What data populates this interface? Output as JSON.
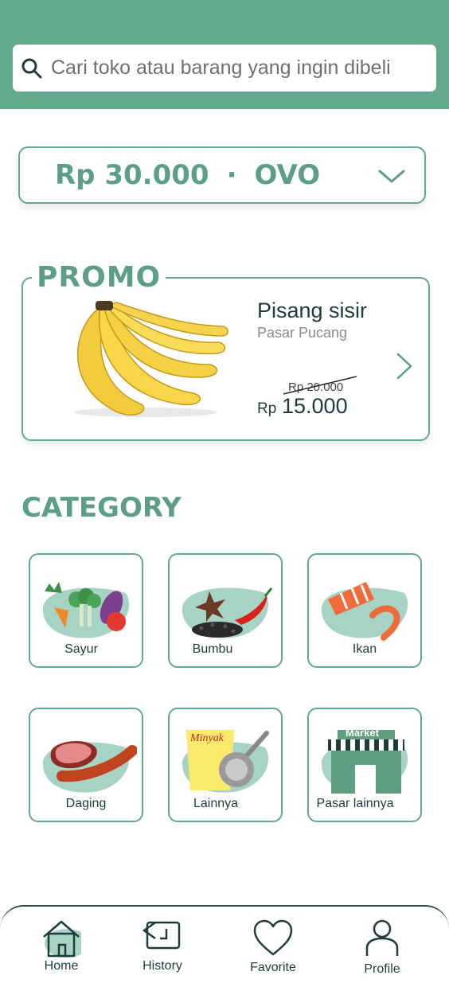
{
  "search": {
    "placeholder": "Cari toko atau barang yang ingin dibeli"
  },
  "wallet": {
    "amount": "Rp 30.000",
    "separator": "·",
    "method": "OVO"
  },
  "promo": {
    "title": "PROMO",
    "product_name": "Pisang sisir",
    "store": "Pasar Pucang",
    "old_price": "Rp 20.000",
    "currency": "Rp",
    "new_price": "15.000"
  },
  "category": {
    "title": "CATEGORY",
    "items": [
      {
        "label": "Sayur",
        "icon": "vegetables-icon"
      },
      {
        "label": "Bumbu",
        "icon": "spices-icon"
      },
      {
        "label": "Ikan",
        "icon": "fish-icon"
      },
      {
        "label": "Daging",
        "icon": "meat-icon"
      },
      {
        "label": "Lainnya",
        "icon": "oil-pan-icon"
      },
      {
        "label": "Pasar lainnya",
        "icon": "market-icon"
      }
    ],
    "market_sign": "Market",
    "oil_label": "Minyak"
  },
  "nav": {
    "items": [
      {
        "label": "Home",
        "icon": "home-icon",
        "active": true
      },
      {
        "label": "History",
        "icon": "history-icon"
      },
      {
        "label": "Favorite",
        "icon": "heart-icon"
      },
      {
        "label": "Profile",
        "icon": "profile-icon"
      }
    ]
  },
  "colors": {
    "primary": "#62a88c",
    "accent_text": "#5c9f86",
    "dark": "#1f3b3a",
    "blob": "#a7d3c4"
  }
}
